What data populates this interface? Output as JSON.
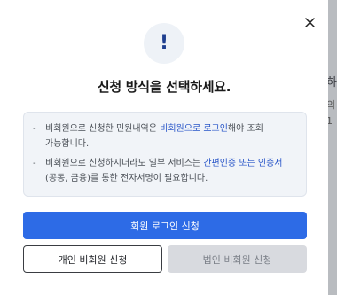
{
  "backdrop": {
    "fragment_1": "하",
    "fragment_2": "의",
    "fragment_3": "1"
  },
  "modal": {
    "close_icon": "close-icon",
    "alert_icon": "exclamation-icon",
    "alert_glyph": "!",
    "title": "신청 방식을 선택하세요.",
    "notices": [
      {
        "before": "비회원으로 신청한 민원내역은 ",
        "highlight": "비회원으로 로그인",
        "after": "해야 조회 가능합니다."
      },
      {
        "before": "비회원으로 신청하시더라도 일부 서비스는 ",
        "highlight": "간편인증 또는 인증서",
        "after": "(공동, 금융)를 통한 전자서명이 필요합니다."
      }
    ],
    "buttons": {
      "member_login": "회원 로그인 신청",
      "individual_guest": "개인 비회원 신청",
      "corporate_guest": "법인 비회원 신청"
    }
  },
  "colors": {
    "primary": "#2d6be6",
    "highlight": "#2855c8",
    "notice_bg": "#f1f4f8",
    "disabled_bg": "#d8dadf"
  }
}
